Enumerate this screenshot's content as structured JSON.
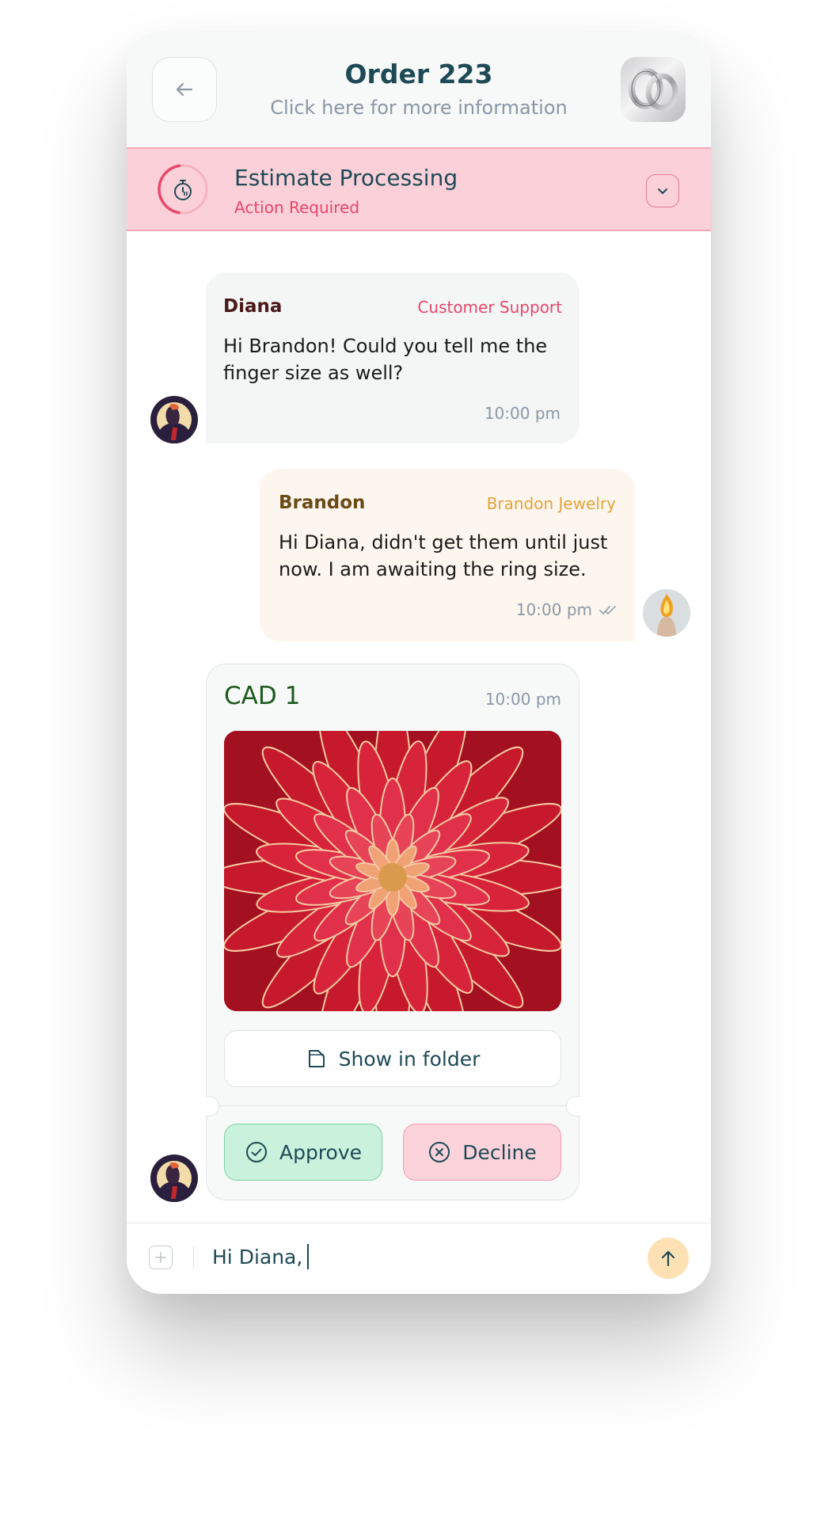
{
  "header": {
    "title": "Order 223",
    "subtitle": "Click here for more information",
    "back_icon": "arrow-left-icon"
  },
  "status_banner": {
    "title": "Estimate Processing",
    "subtitle": "Action Required",
    "icon": "timer-icon",
    "expand_icon": "chevron-down-icon",
    "progress": 0.45
  },
  "messages": [
    {
      "sender": "Diana",
      "role": "Customer Support",
      "text": "Hi Brandon! Could you tell me the finger size as well?",
      "time": "10:00 pm"
    },
    {
      "sender": "Brandon",
      "role": "Brandon Jewelry",
      "text": "Hi Diana, didn't get them until just now. I am awaiting the ring size.",
      "time": "10:00 pm",
      "read_icon": "double-check-icon"
    }
  ],
  "cad_card": {
    "title": "CAD 1",
    "time": "10:00 pm",
    "show_in_folder": "Show in folder",
    "approve": "Approve",
    "decline": "Decline"
  },
  "composer": {
    "value": "Hi Diana,",
    "attach_icon": "plus-icon",
    "send_icon": "arrow-up-icon"
  },
  "colors": {
    "accent_teal": "#1d4a55",
    "banner_pink": "#fbd0d9",
    "alert_red": "#e8466b",
    "support_red": "#e8466b",
    "brandon_brown": "#6b4a16",
    "jewelry_orange": "#e3a33a",
    "diana_maroon": "#4a1818",
    "cad_green": "#1d5a1d",
    "approve_green": "#c9f1dc",
    "decline_pink": "#fcd2db",
    "send_peach": "#fde1b4"
  }
}
